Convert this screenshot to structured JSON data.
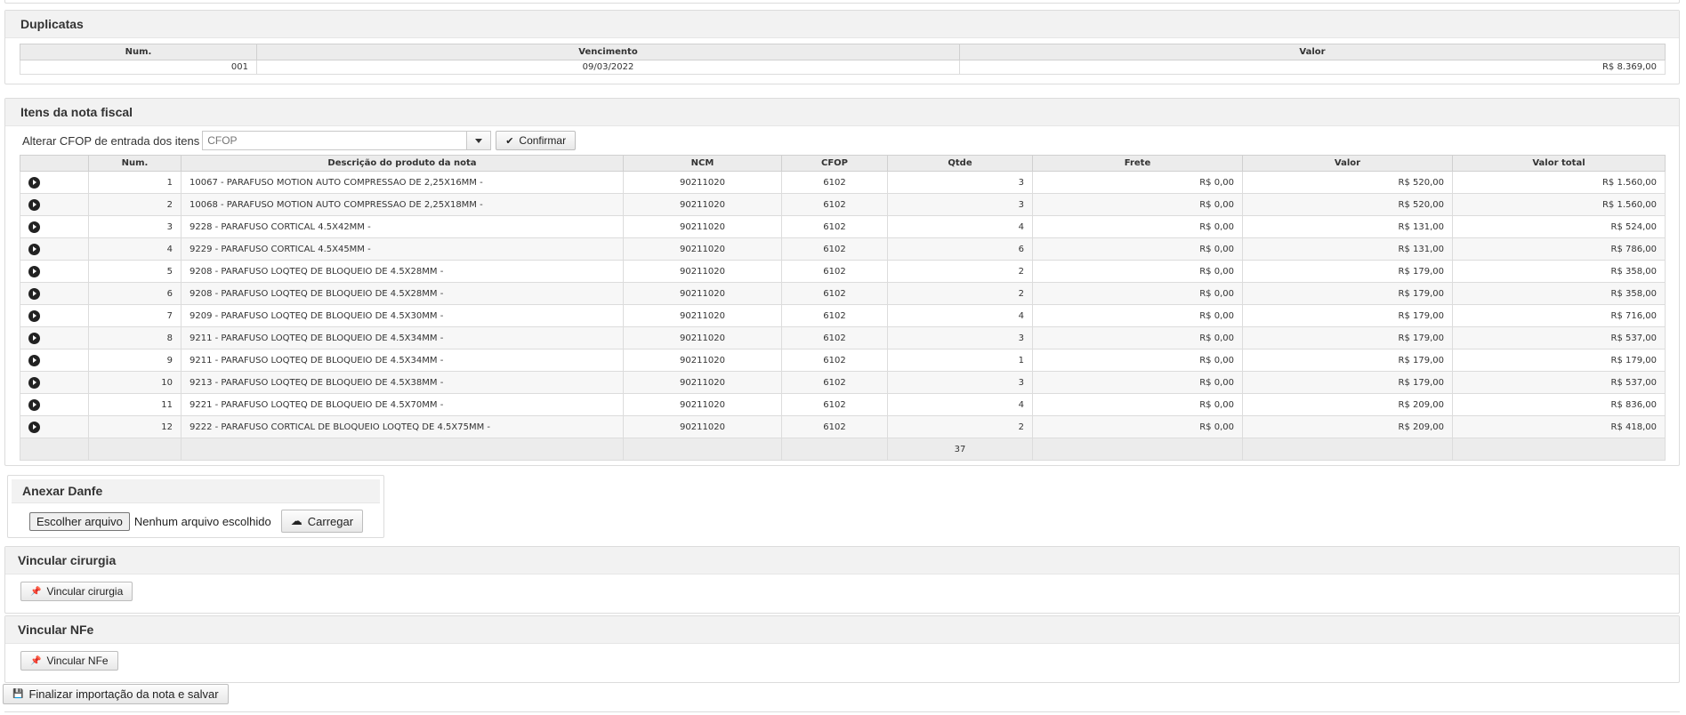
{
  "duplicatas": {
    "title": "Duplicatas",
    "headers": {
      "num": "Num.",
      "vencimento": "Vencimento",
      "valor": "Valor"
    },
    "rows": [
      {
        "num": "001",
        "vencimento": "09/03/2022",
        "valor": "R$ 8.369,00"
      }
    ]
  },
  "itens": {
    "title": "Itens da nota fiscal",
    "cfop_label": "Alterar CFOP de entrada dos itens",
    "cfop_placeholder": "CFOP",
    "confirm_label": "Confirmar",
    "headers": {
      "num": "Num.",
      "descricao": "Descrição do produto da nota",
      "ncm": "NCM",
      "cfop": "CFOP",
      "qtde": "Qtde",
      "frete": "Frete",
      "valor": "Valor",
      "total": "Valor total"
    },
    "rows": [
      {
        "num": "1",
        "descricao": "10067 - PARAFUSO MOTION AUTO COMPRESSAO DE 2,25X16MM -",
        "ncm": "90211020",
        "cfop": "6102",
        "qtde": "3",
        "frete": "R$ 0,00",
        "valor": "R$ 520,00",
        "total": "R$ 1.560,00"
      },
      {
        "num": "2",
        "descricao": "10068 - PARAFUSO MOTION AUTO COMPRESSAO DE 2,25X18MM -",
        "ncm": "90211020",
        "cfop": "6102",
        "qtde": "3",
        "frete": "R$ 0,00",
        "valor": "R$ 520,00",
        "total": "R$ 1.560,00"
      },
      {
        "num": "3",
        "descricao": "9228 - PARAFUSO CORTICAL 4.5X42MM -",
        "ncm": "90211020",
        "cfop": "6102",
        "qtde": "4",
        "frete": "R$ 0,00",
        "valor": "R$ 131,00",
        "total": "R$ 524,00"
      },
      {
        "num": "4",
        "descricao": "9229 - PARAFUSO CORTICAL 4.5X45MM -",
        "ncm": "90211020",
        "cfop": "6102",
        "qtde": "6",
        "frete": "R$ 0,00",
        "valor": "R$ 131,00",
        "total": "R$ 786,00"
      },
      {
        "num": "5",
        "descricao": "9208 - PARAFUSO LOQTEQ DE BLOQUEIO DE 4.5X28MM -",
        "ncm": "90211020",
        "cfop": "6102",
        "qtde": "2",
        "frete": "R$ 0,00",
        "valor": "R$ 179,00",
        "total": "R$ 358,00"
      },
      {
        "num": "6",
        "descricao": "9208 - PARAFUSO LOQTEQ DE BLOQUEIO DE 4.5X28MM -",
        "ncm": "90211020",
        "cfop": "6102",
        "qtde": "2",
        "frete": "R$ 0,00",
        "valor": "R$ 179,00",
        "total": "R$ 358,00"
      },
      {
        "num": "7",
        "descricao": "9209 - PARAFUSO LOQTEQ DE BLOQUEIO DE 4.5X30MM -",
        "ncm": "90211020",
        "cfop": "6102",
        "qtde": "4",
        "frete": "R$ 0,00",
        "valor": "R$ 179,00",
        "total": "R$ 716,00"
      },
      {
        "num": "8",
        "descricao": "9211 - PARAFUSO LOQTEQ DE BLOQUEIO DE 4.5X34MM -",
        "ncm": "90211020",
        "cfop": "6102",
        "qtde": "3",
        "frete": "R$ 0,00",
        "valor": "R$ 179,00",
        "total": "R$ 537,00"
      },
      {
        "num": "9",
        "descricao": "9211 - PARAFUSO LOQTEQ DE BLOQUEIO DE 4.5X34MM -",
        "ncm": "90211020",
        "cfop": "6102",
        "qtde": "1",
        "frete": "R$ 0,00",
        "valor": "R$ 179,00",
        "total": "R$ 179,00"
      },
      {
        "num": "10",
        "descricao": "9213 - PARAFUSO LOQTEQ DE BLOQUEIO DE 4.5X38MM -",
        "ncm": "90211020",
        "cfop": "6102",
        "qtde": "3",
        "frete": "R$ 0,00",
        "valor": "R$ 179,00",
        "total": "R$ 537,00"
      },
      {
        "num": "11",
        "descricao": "9221 - PARAFUSO LOQTEQ DE BLOQUEIO DE 4.5X70MM -",
        "ncm": "90211020",
        "cfop": "6102",
        "qtde": "4",
        "frete": "R$ 0,00",
        "valor": "R$ 209,00",
        "total": "R$ 836,00"
      },
      {
        "num": "12",
        "descricao": "9222 - PARAFUSO CORTICAL DE BLOQUEIO LOQTEQ DE 4.5X75MM -",
        "ncm": "90211020",
        "cfop": "6102",
        "qtde": "2",
        "frete": "R$ 0,00",
        "valor": "R$ 209,00",
        "total": "R$ 418,00"
      }
    ],
    "footer_qtde_total": "37"
  },
  "danfe": {
    "title": "Anexar Danfe",
    "choose_label": "Escolher arquivo",
    "no_file_label": "Nenhum arquivo escolhido",
    "upload_label": "Carregar"
  },
  "cirurgia": {
    "title": "Vincular cirurgia",
    "button_label": "Vincular cirurgia"
  },
  "nfe": {
    "title": "Vincular NFe",
    "button_label": "Vincular NFe"
  },
  "finalizar": {
    "button_label": "Finalizar importação da nota e salvar"
  }
}
